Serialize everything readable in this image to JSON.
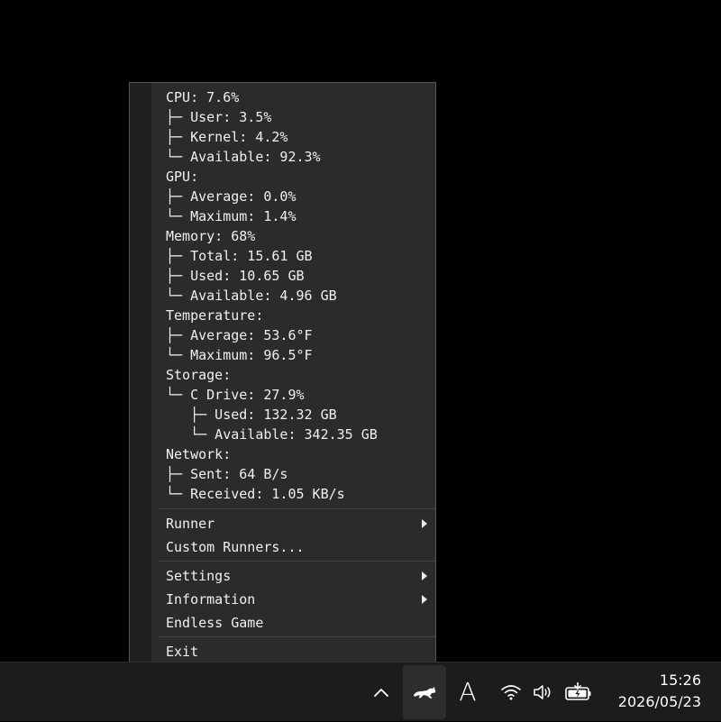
{
  "stats": [
    "CPU: 7.6%",
    "├─ User: 3.5%",
    "├─ Kernel: 4.2%",
    "└─ Available: 92.3%",
    "GPU:",
    "├─ Average: 0.0%",
    "└─ Maximum: 1.4%",
    "Memory: 68%",
    "├─ Total: 15.61 GB",
    "├─ Used: 10.65 GB",
    "└─ Available: 4.96 GB",
    "Temperature:",
    "├─ Average: 53.6°F",
    "└─ Maximum: 96.5°F",
    "Storage:",
    "└─ C Drive: 27.9%",
    "   ├─ Used: 132.32 GB",
    "   └─ Available: 342.35 GB",
    "Network:",
    "├─ Sent: 64 B/s",
    "└─ Received: 1.05 KB/s"
  ],
  "menu": {
    "runner": "Runner",
    "custom_runners": "Custom Runners...",
    "settings": "Settings",
    "information": "Information",
    "endless_game": "Endless Game",
    "exit": "Exit"
  },
  "taskbar": {
    "ime": "A",
    "time": "15:26",
    "date": "2026/05/23"
  },
  "icons": {
    "overflow": "chevron-up-icon",
    "runcat": "running-cat-icon",
    "wifi": "wifi-icon",
    "volume": "speaker-icon",
    "battery": "battery-charging-icon"
  },
  "colors": {
    "menu_bg": "#2b2b2b",
    "menu_strip": "#202020",
    "taskbar_bg": "#1c1c1c",
    "text": "#f0f0f0"
  }
}
